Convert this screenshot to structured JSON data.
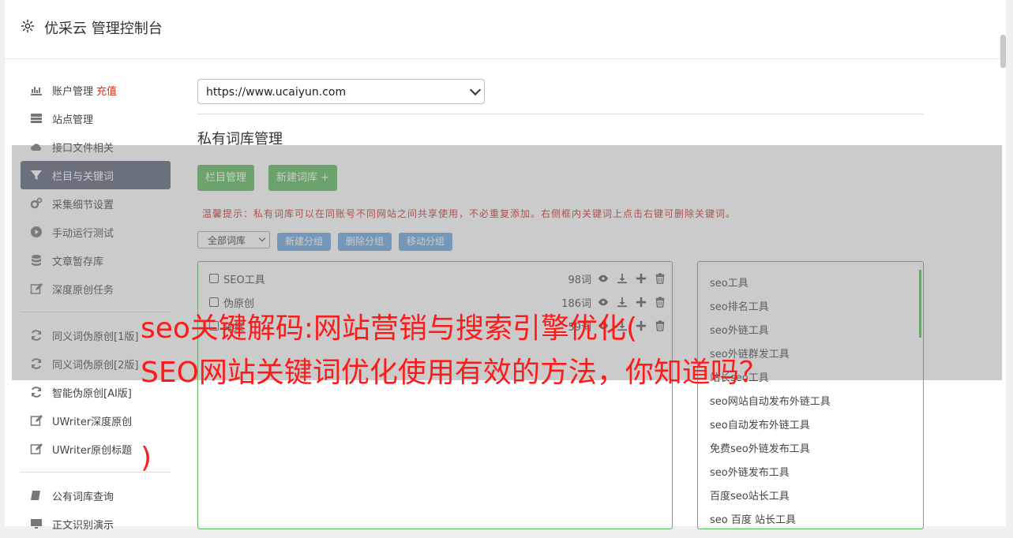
{
  "header": {
    "title": "优采云 管理控制台"
  },
  "sidebar": {
    "groups": [
      [
        {
          "icon": "bar-chart-icon",
          "label": "账户管理",
          "badge": "充值"
        },
        {
          "icon": "server-icon",
          "label": "站点管理"
        },
        {
          "icon": "cloud-upload-icon",
          "label": "接口文件相关"
        },
        {
          "icon": "filter-icon",
          "label": "栏目与关键词",
          "active": true
        },
        {
          "icon": "gears-icon",
          "label": "采集细节设置"
        },
        {
          "icon": "play-circle-icon",
          "label": "手动运行测试"
        },
        {
          "icon": "database-icon",
          "label": "文章暂存库"
        },
        {
          "icon": "edit-icon",
          "label": "深度原创任务"
        }
      ],
      [
        {
          "icon": "refresh-icon",
          "label": "同义词伪原创[1版]"
        },
        {
          "icon": "refresh-icon",
          "label": "同义词伪原创[2版]"
        },
        {
          "icon": "refresh-icon",
          "label": "智能伪原创[AI版]"
        },
        {
          "icon": "edit-icon",
          "label": "UWriter深度原创"
        },
        {
          "icon": "edit-icon",
          "label": "UWriter原创标题"
        }
      ],
      [
        {
          "icon": "book-icon",
          "label": "公有词库查询"
        },
        {
          "icon": "monitor-icon",
          "label": "正文识别演示"
        }
      ]
    ]
  },
  "main": {
    "site_select": "https://www.ucaiyun.com",
    "section_title": "私有词库管理",
    "btn_columns": "栏目管理",
    "btn_new_lib": "新建词库 +",
    "tip": "温馨提示：私有词库可以在同账号不同网站之间共享使用，不必重复添加。右侧框内关键词上点击右键可删除关键词。",
    "lib_filter": "全部词库",
    "btn_new_group": "新建分组",
    "btn_del_group": "删除分组",
    "btn_move_group": "移动分组",
    "wordlists": [
      {
        "name": "SEO工具",
        "count": "98词"
      },
      {
        "name": "伪原创",
        "count": "186词"
      },
      {
        "name": "采集",
        "count": "59词"
      }
    ],
    "keywords": [
      "seo工具",
      "seo排名工具",
      "seo外链工具",
      "seo外链群发工具",
      "站长seo工具",
      "seo网站自动发布外链工具",
      "seo自动发布外链工具",
      "免费seo外链发布工具",
      "seo外链发布工具",
      "百度seo站长工具",
      "seo 百度 站长工具"
    ]
  },
  "overlay": {
    "line1": "seo关键解码:网站营销与搜索引擎优化(",
    "line2": "SEO网站关键词优化使用有效的方法，你知道吗？",
    "line3": ")"
  },
  "colors": {
    "accent_green": "#5cb85c",
    "accent_blue": "#6ba6e0",
    "active_nav": "#5b6578",
    "warning": "#c9302c",
    "headline": "#ff1a1a"
  }
}
